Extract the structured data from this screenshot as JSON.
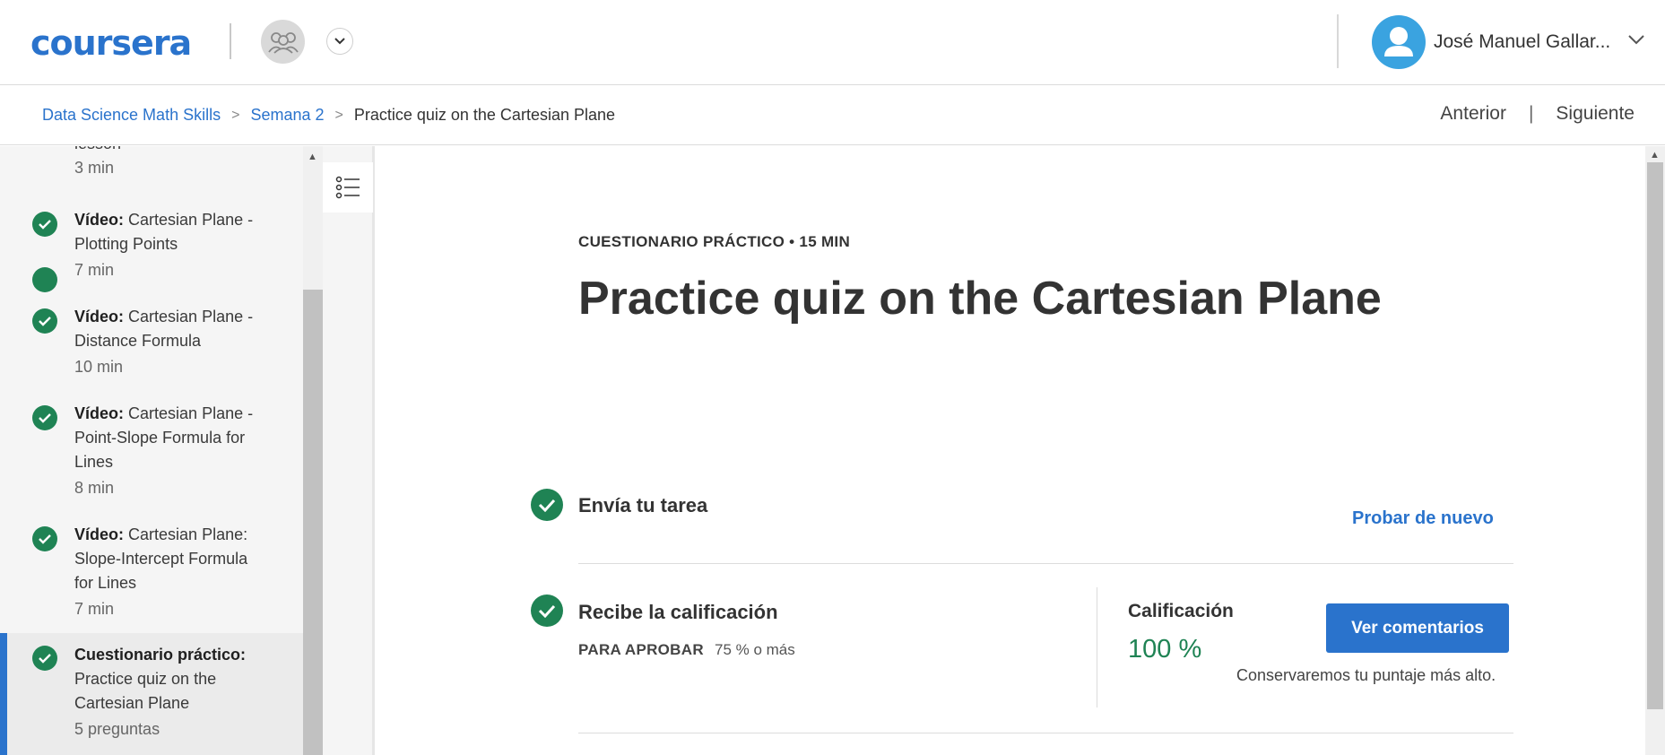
{
  "header": {
    "logo_text": "coursera",
    "user_name": "José Manuel Gallar..."
  },
  "breadcrumb": {
    "course": "Data Science Math Skills",
    "week": "Semana 2",
    "current": "Practice quiz on the Cartesian Plane",
    "separator": ">"
  },
  "nav": {
    "prev": "Anterior",
    "divider": "|",
    "next": "Siguiente"
  },
  "sidebar": {
    "partial_item": {
      "title": "lesson",
      "duration": "3 min"
    },
    "items": [
      {
        "type": "Vídeo:",
        "title": "Cartesian Plane - Plotting Points",
        "duration": "7 min",
        "completed": true
      },
      {
        "type": "Vídeo:",
        "title": "Cartesian Plane - Distance Formula",
        "duration": "10 min",
        "completed": true
      },
      {
        "type": "Vídeo:",
        "title": "Cartesian Plane - Point-Slope Formula for Lines",
        "duration": "8 min",
        "completed": true
      },
      {
        "type": "Vídeo:",
        "title": "Cartesian Plane: Slope-Intercept Formula for Lines",
        "duration": "7 min",
        "completed": true
      },
      {
        "type": "Cuestionario práctico:",
        "title": "Practice quiz on the Cartesian Plane",
        "duration": "5 preguntas",
        "completed": true,
        "active": true
      }
    ]
  },
  "main": {
    "kicker": "CUESTIONARIO PRÁCTICO • 15 MIN",
    "title": "Practice quiz on the Cartesian Plane",
    "submit_step": {
      "title": "Envía tu tarea",
      "action": "Probar de nuevo"
    },
    "grade_step": {
      "title": "Recibe la calificación",
      "pass_label": "PARA APROBAR",
      "pass_value": "75 % o más",
      "grade_label": "Calificación",
      "grade_value": "100 %",
      "button": "Ver comentarios",
      "note": "Conservaremos tu puntaje más alto."
    }
  },
  "colors": {
    "brand": "#2a73cc",
    "success": "#1f8354",
    "avatar": "#3aa3e0"
  }
}
